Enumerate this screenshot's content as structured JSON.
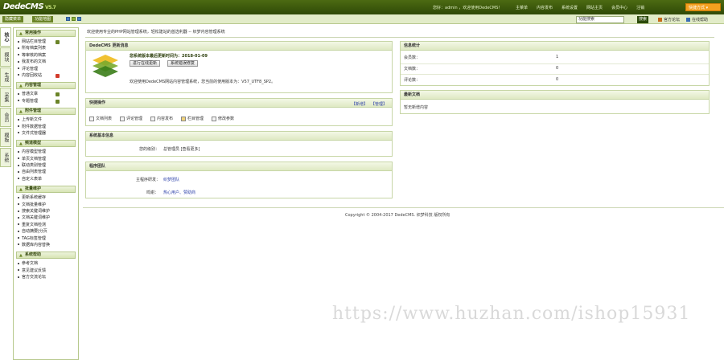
{
  "topbar": {
    "logo": "DedeCMS",
    "version": "V5.7",
    "welcome": "您好：admin ，欢迎使用DedeCMS！",
    "nav": [
      "主菜单",
      "内容发布",
      "系统设置",
      "网站主页",
      "会员中心",
      "注销"
    ],
    "quick_menu": "快捷方式"
  },
  "subbar": {
    "tabs": [
      "隐藏菜单",
      "功能地图"
    ],
    "search_value": "功能搜索",
    "search_button": "搜索",
    "links": [
      "官方论坛",
      "在线帮助"
    ]
  },
  "vtabs": [
    "核心",
    "模块",
    "生成",
    "采集",
    "会员",
    "模板",
    "系统"
  ],
  "sidebar": {
    "groups": [
      {
        "title": "常用操作",
        "items": [
          "网站栏目管理",
          "所有档案列表",
          "等审核的档案",
          "我发布的文档",
          "评论管理",
          "内容回收站"
        ]
      },
      {
        "title": "内容管理",
        "items": [
          "普通文章",
          "专题管理"
        ]
      },
      {
        "title": "附件管理",
        "items": [
          "上传新文件",
          "附件数据管理",
          "文件式管理器"
        ]
      },
      {
        "title": "频道模型",
        "items": [
          "内容模型管理",
          "单页文档管理",
          "联动类别管理",
          "自由列表管理",
          "自定义表单"
        ]
      },
      {
        "title": "批量维护",
        "items": [
          "更新系统缓存",
          "文档批量维护",
          "搜索关键词维护",
          "文档关键词维护",
          "重复文档检测",
          "自动摘要|分页",
          "TAG标签管理",
          "数据库内容替换"
        ]
      },
      {
        "title": "系统帮助",
        "items": [
          "参考文档",
          "意见建议反馈",
          "官方交流论坛"
        ]
      }
    ]
  },
  "breadcrumb": "欢迎使用专业的PHP网站管理系统，轻松建站的首选利器 -- 织梦内容管理系统",
  "update_panel": {
    "title": "DedeCMS 更新消息",
    "release_line": "您系统版本最后更新时间为：2018-01-09",
    "btn_online_update": "进行在线更新",
    "btn_sys_check": "系统错误修复",
    "message": "欢迎使用DedeCMS网站内容管理系统，您当前的使用版本为：V57_UTF8_SP2。"
  },
  "quick_panel": {
    "title": "快捷操作",
    "right_links": [
      "【新增】",
      "【管理】"
    ],
    "items": [
      "文档列表",
      "评论管理",
      "内容发布",
      "栏目管理",
      "修改参数"
    ]
  },
  "sysinfo_panel": {
    "title": "系统基本信息",
    "label": "您的级别：",
    "value": "总管理员 [查看更多]"
  },
  "team_panel": {
    "title": "程序团队",
    "rows": [
      {
        "label": "主程序研发：",
        "value": "织梦团队"
      },
      {
        "label": "鸣谢：",
        "value": "热心用户、赞助商"
      }
    ]
  },
  "stats_panel": {
    "title": "信息统计",
    "rows": [
      {
        "label": "会员数：",
        "value": "1"
      },
      {
        "label": "文档数：",
        "value": "0"
      },
      {
        "label": "评论数：",
        "value": "0"
      }
    ]
  },
  "latest_panel": {
    "title": "最新文档",
    "empty": "暂无新增内容"
  },
  "copyright": "Copyright © 2004-2017 DedeCMS. 织梦科技 版权所有",
  "watermark": "https://www.huzhan.com/ishop15931"
}
